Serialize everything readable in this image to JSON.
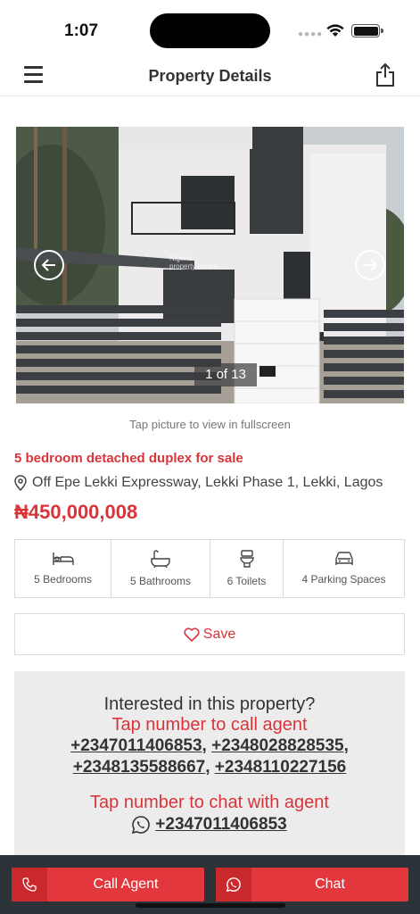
{
  "status": {
    "time": "1:07"
  },
  "nav": {
    "title": "Property Details"
  },
  "photo": {
    "counter": "1 of 13",
    "watermark_line1": "Nigeria",
    "watermark_line2": "property centre"
  },
  "tap_hint": "Tap picture to view in fullscreen",
  "property": {
    "title": "5 bedroom detached duplex for sale",
    "location": "Off Epe Lekki Expressway, Lekki Phase 1, Lekki, Lagos",
    "price": "₦450,000,008"
  },
  "features": [
    {
      "icon": "bed-icon",
      "label": "5 Bedrooms"
    },
    {
      "icon": "bathtub-icon",
      "label": "5 Bathrooms"
    },
    {
      "icon": "toilet-icon",
      "label": "6 Toilets"
    },
    {
      "icon": "car-icon",
      "label": "4 Parking Spaces"
    }
  ],
  "save_label": "Save",
  "contact": {
    "question": "Interested in this property?",
    "call_hint": "Tap number to call agent",
    "phones": [
      "+2347011406853",
      "+2348028828535",
      "+2348135588667",
      "+2348110227156"
    ],
    "chat_hint": "Tap number to chat with agent",
    "whatsapp": "+2347011406853"
  },
  "bottom": {
    "call_label": "Call Agent",
    "chat_label": "Chat"
  },
  "colors": {
    "accent": "#d8343a",
    "bottom_bar": "#2b3338"
  }
}
